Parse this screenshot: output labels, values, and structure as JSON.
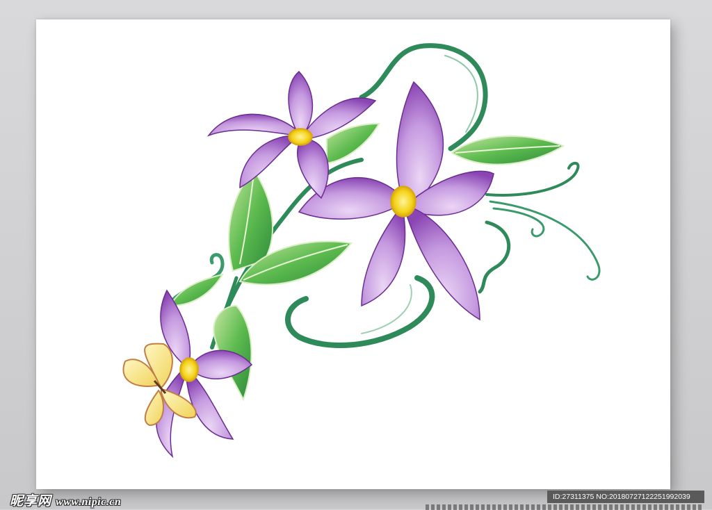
{
  "watermark": {
    "site_logo": "昵享网",
    "site_url": "www.nipic.cn",
    "image_id_text": "ID:27311375 NO:20180727122251992039"
  },
  "colors": {
    "petal_purple": "#a46bc6",
    "petal_light": "#d6b5ea",
    "leaf_green": "#4fae45",
    "stem_green": "#2f8a5a",
    "flower_center": "#f4d31a",
    "butterfly_wing": "#f3e27a",
    "butterfly_edge": "#e0a36c"
  },
  "illustration": {
    "subject": "purple-lilies-with-butterfly",
    "flowers": 3,
    "butterflies": 1
  }
}
